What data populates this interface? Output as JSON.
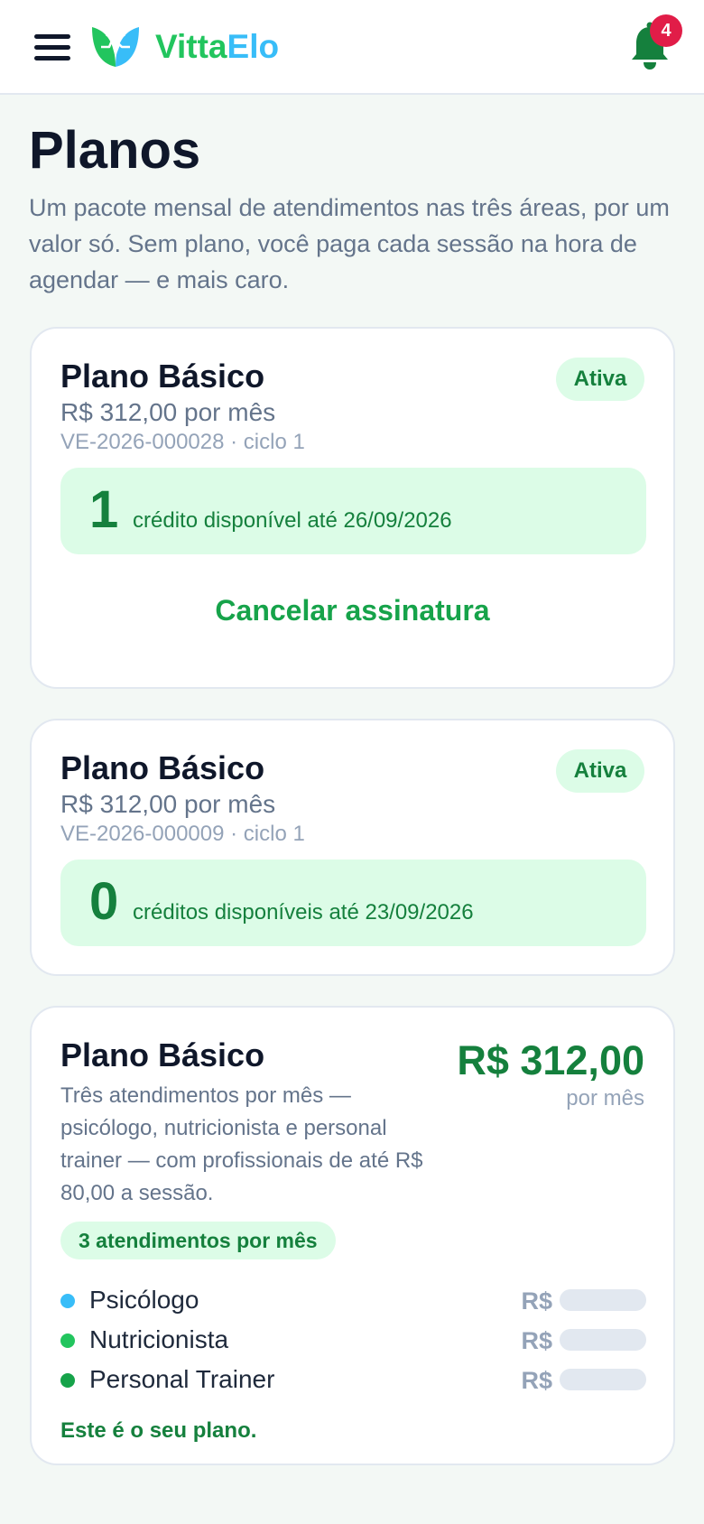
{
  "header": {
    "brand_part1": "Vitta",
    "brand_part2": "Elo",
    "notification_count": "4",
    "icons": [
      "menu-icon",
      "logo-leaf-icon",
      "bell-icon"
    ],
    "colors": {
      "brand_green": "#22c55e",
      "brand_blue": "#38bdf8",
      "badge": "#e11d48"
    }
  },
  "page": {
    "title": "Planos",
    "intro": "Um pacote mensal de atendimentos nas três áreas, por um valor só. Sem plano, você paga cada sessão na hora de agendar — e mais caro."
  },
  "subscriptions": [
    {
      "name": "Plano Básico",
      "price": "R$ 312,00 por mês",
      "code": "VE-2026-000028 · ciclo 1",
      "status": "Ativa",
      "credits": "1",
      "credits_text": "crédito disponível até 26/09/2026",
      "cancel_label": "Cancelar assinatura"
    },
    {
      "name": "Plano Básico",
      "price": "R$ 312,00 por mês",
      "code": "VE-2026-000009 · ciclo 1",
      "status": "Ativa",
      "credits": "0",
      "credits_text": "créditos disponíveis até 23/09/2026"
    }
  ],
  "offer": {
    "name": "Plano Básico",
    "price": "R$ 312,00",
    "period": "por mês",
    "description": "Três atendimentos por mês — psicólogo, nutricionista e personal trainer — com profissionais de até R$ 80,00 a sessão.",
    "pill": "3 atendimentos por mês",
    "services": [
      {
        "name": "Psicólogo",
        "currency": "R$",
        "dot_color": "#38bdf8"
      },
      {
        "name": "Nutricionista",
        "currency": "R$",
        "dot_color": "#22c55e"
      },
      {
        "name": "Personal Trainer",
        "currency": "R$",
        "dot_color": "#16a34a"
      }
    ],
    "current_note": "Este é o seu plano."
  }
}
